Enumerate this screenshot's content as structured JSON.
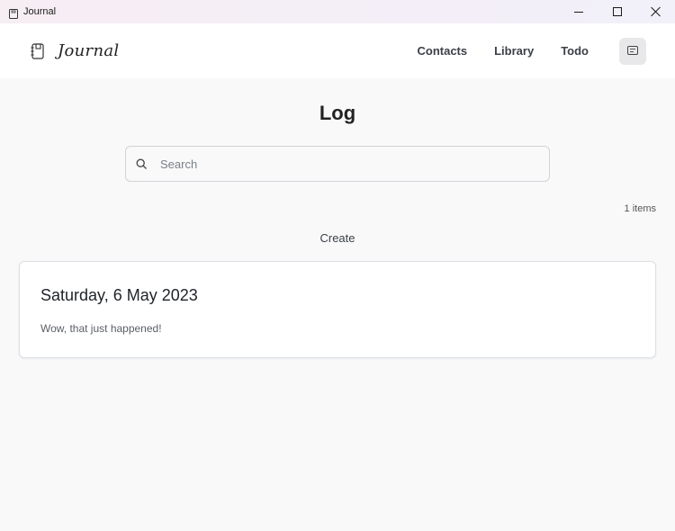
{
  "window": {
    "title": "Journal",
    "icon": "notebook-icon",
    "controls": [
      "minimize-icon",
      "maximize-icon",
      "close-icon"
    ]
  },
  "navbar": {
    "brand": "Journal",
    "brand_icon": "notebook-icon",
    "links": [
      "Contacts",
      "Library",
      "Todo"
    ],
    "theme_icon": "card-icon"
  },
  "main": {
    "title": "Log",
    "search": {
      "placeholder": "Search",
      "value": ""
    },
    "count": "1 items",
    "create_label": "Create",
    "entries": [
      {
        "date": "Saturday, 6 May 2023",
        "body": "Wow, that just happened!"
      }
    ]
  },
  "colors": {
    "background": "#f9f9f9",
    "surface": "#ffffff",
    "button_bg": "#e8e8eb",
    "border": "#d0d3d8"
  }
}
